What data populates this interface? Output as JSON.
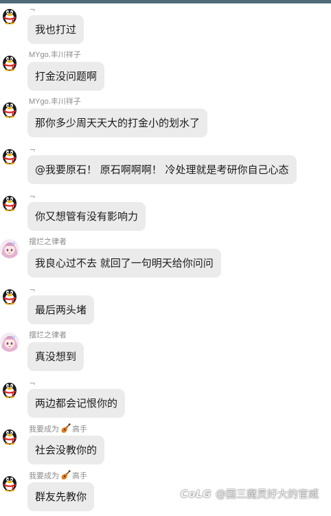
{
  "chat": {
    "messages": [
      {
        "avatar": "qq-penguin-icon",
        "sender": "ᆨ",
        "text": "我也打过"
      },
      {
        "avatar": "qq-penguin-icon",
        "sender": "MYgo.丰川祥子",
        "text": "打金没问题啊"
      },
      {
        "avatar": "qq-penguin-icon",
        "sender": "MYgo.丰川祥子",
        "text": "那你多少周天天大的打金小的划水了"
      },
      {
        "avatar": "qq-penguin-icon",
        "sender": "ᆨ",
        "text": "@我要原石！ 原石啊啊啊！ 冷处理就是考研你自己心态"
      },
      {
        "avatar": "qq-penguin-icon",
        "sender": "ᆨ",
        "text": "你又想管有没有影响力"
      },
      {
        "avatar": "anime-girl-avatar",
        "sender": "摆烂之律者",
        "text": "我良心过不去 就回了一句明天给你问问"
      },
      {
        "avatar": "qq-penguin-icon",
        "sender": "ᆨ",
        "text": "最后两头堵"
      },
      {
        "avatar": "anime-girl-avatar",
        "sender": "摆烂之律者",
        "text": "真没想到"
      },
      {
        "avatar": "qq-penguin-icon",
        "sender": "ᆨ",
        "text": "两边都会记恨你的"
      },
      {
        "avatar": "qq-penguin-icon",
        "sender_prefix": "我要成为",
        "sender_badge": "guitar-icon",
        "sender_suffix": "高手",
        "text": "社会没教你的"
      },
      {
        "avatar": "qq-penguin-icon",
        "sender_prefix": "我要成为",
        "sender_badge": "guitar-icon",
        "sender_suffix": "高手",
        "text": "群友先教你"
      }
    ]
  },
  "watermark": {
    "logo": "CoLG",
    "text": "@国三魔灵好大的官威"
  },
  "colors": {
    "bubble": "#ebebeb",
    "topbar": "#4f6a78",
    "sender_name": "#8a8a8a"
  }
}
